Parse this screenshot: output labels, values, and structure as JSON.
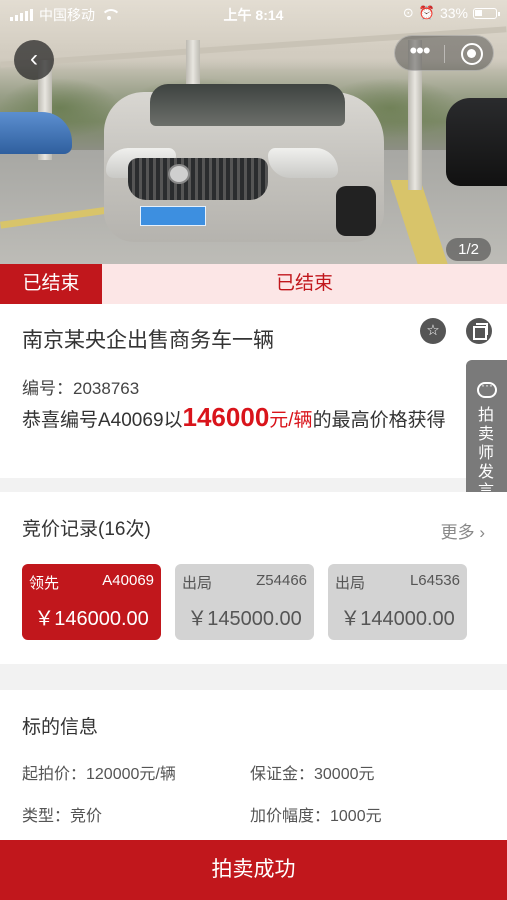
{
  "status_bar": {
    "carrier": "中国移动",
    "time": "上午 8:14",
    "battery": "33%"
  },
  "gallery": {
    "counter": "1/2"
  },
  "status": {
    "tag": "已结束",
    "center": "已结束"
  },
  "item": {
    "title": "南京某央企出售商务车一辆",
    "lot_label": "编号：",
    "lot_number": "2038763",
    "congrats_prefix": "恭喜编号A40069以",
    "final_price": "146000",
    "price_unit": "元/辆",
    "congrats_suffix": "的最高价格获得"
  },
  "side_tab": {
    "label": "拍卖师发言"
  },
  "bids": {
    "title": "竞价记录(16次)",
    "more": "更多",
    "records": [
      {
        "status": "领先",
        "bidder": "A40069",
        "amount": "￥146000.00"
      },
      {
        "status": "出局",
        "bidder": "Z54466",
        "amount": "￥145000.00"
      },
      {
        "status": "出局",
        "bidder": "L64536",
        "amount": "￥144000.00"
      }
    ]
  },
  "target_info": {
    "title": "标的信息",
    "start_price": "起拍价：120000元/辆",
    "deposit": "保证金：30000元",
    "type": "类型：竞价",
    "increment": "加价幅度：1000元"
  },
  "bottom_bar": {
    "label": "拍卖成功"
  },
  "colors": {
    "accent": "#c1171c",
    "price_red": "#d9141b",
    "ribbon_bg": "#fce6e6"
  }
}
